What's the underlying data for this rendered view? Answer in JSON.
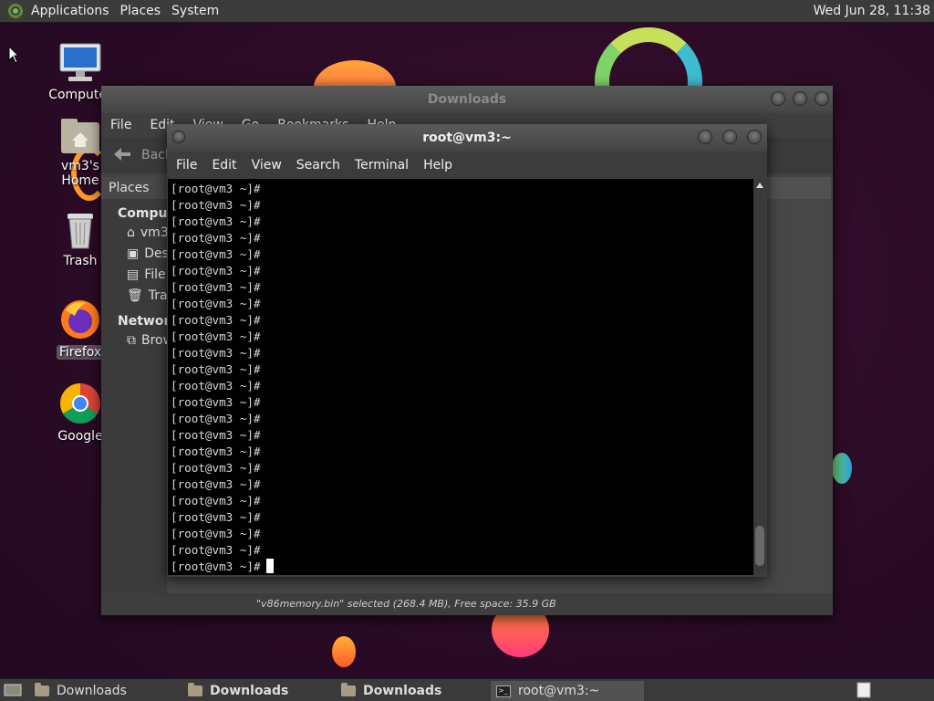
{
  "top_panel": {
    "menus": [
      "Applications",
      "Places",
      "System"
    ],
    "clock": "Wed Jun 28, 11:38"
  },
  "desktop": {
    "icons": [
      {
        "label": "Computer",
        "icon": "computer-icon"
      },
      {
        "label": "vm3's Home",
        "icon": "home-folder-icon"
      },
      {
        "label": "Trash",
        "icon": "trash-icon"
      },
      {
        "label": "Firefox",
        "icon": "firefox-icon"
      },
      {
        "label": "Google",
        "icon": "chrome-icon"
      }
    ]
  },
  "file_manager": {
    "title": "Downloads",
    "menus": [
      "File",
      "Edit",
      "View",
      "Go",
      "Bookmarks",
      "Help"
    ],
    "back_label": "Back",
    "sidebar_header": "Places",
    "sections": [
      {
        "title": "Computer",
        "items": [
          {
            "label": "vm3",
            "icon": "home-icon"
          },
          {
            "label": "Desktop",
            "icon": "desktop-icon"
          },
          {
            "label": "File System",
            "icon": "drive-icon"
          },
          {
            "label": "Trash",
            "icon": "trash-icon"
          }
        ]
      },
      {
        "title": "Network",
        "items": [
          {
            "label": "Browse Network",
            "icon": "network-icon"
          }
        ]
      }
    ],
    "status": "\"v86memory.bin\" selected (268.4 MB), Free space: 35.9 GB"
  },
  "terminal": {
    "title": "root@vm3:~",
    "menus": [
      "File",
      "Edit",
      "View",
      "Search",
      "Terminal",
      "Help"
    ],
    "prompt": "[root@vm3 ~]#",
    "line_count": 24
  },
  "taskbar": {
    "tasks": [
      {
        "label": "Downloads",
        "icon": "folder-icon",
        "bold": false,
        "active": false
      },
      {
        "label": "Downloads",
        "icon": "folder-icon",
        "bold": true,
        "active": false
      },
      {
        "label": "Downloads",
        "icon": "folder-icon",
        "bold": true,
        "active": false
      },
      {
        "label": "root@vm3:~",
        "icon": "terminal-icon",
        "bold": false,
        "active": true
      }
    ]
  },
  "colors": {
    "background": "#2b0b26",
    "panel": "#3b3b3b",
    "terminal_bg": "#000000"
  }
}
